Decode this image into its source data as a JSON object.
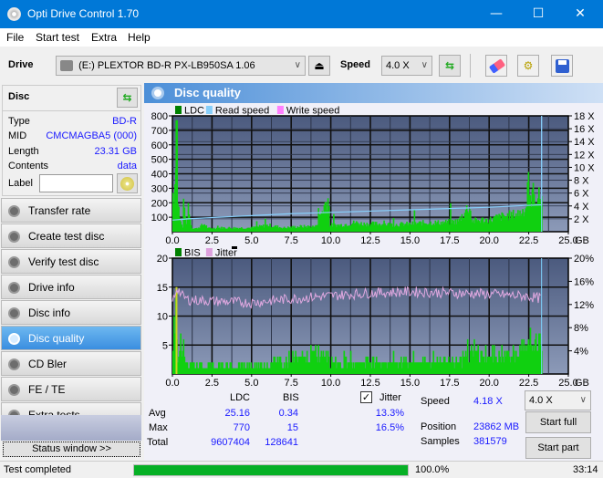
{
  "window": {
    "title": "Opti Drive Control 1.70",
    "minimize": "—",
    "maximize": "☐",
    "close": "✕"
  },
  "menu": [
    "File",
    "Start test",
    "Extra",
    "Help"
  ],
  "toolbar": {
    "drive_label": "Drive",
    "drive_value": "(E:)  PLEXTOR BD-R  PX-LB950SA 1.06",
    "speed_label": "Speed",
    "speed_value": "4.0 X"
  },
  "disc": {
    "title": "Disc",
    "rows": [
      {
        "label": "Type",
        "value": "BD-R"
      },
      {
        "label": "MID",
        "value": "CMCMAGBA5 (000)"
      },
      {
        "label": "Length",
        "value": "23.31 GB"
      },
      {
        "label": "Contents",
        "value": "data"
      }
    ],
    "label_field": {
      "label": "Label",
      "value": ""
    }
  },
  "nav": [
    {
      "label": "Transfer rate",
      "active": false
    },
    {
      "label": "Create test disc",
      "active": false
    },
    {
      "label": "Verify test disc",
      "active": false
    },
    {
      "label": "Drive info",
      "active": false
    },
    {
      "label": "Disc info",
      "active": false
    },
    {
      "label": "Disc quality",
      "active": true
    },
    {
      "label": "CD Bler",
      "active": false
    },
    {
      "label": "FE / TE",
      "active": false
    },
    {
      "label": "Extra tests",
      "active": false
    }
  ],
  "status_window_button": "Status window >>",
  "panel_title": "Disc quality",
  "chart_data": [
    {
      "type": "bar",
      "title": "LDC / Read speed",
      "legend": [
        "LDC",
        "Read speed",
        "Write speed"
      ],
      "legend_colors": {
        "LDC": "#008000",
        "Read speed": "#87cefa",
        "Write speed": "#ff80ff"
      },
      "xlabel": "GB",
      "xlim": [
        0,
        25
      ],
      "x_ticks": [
        "0.0",
        "2.5",
        "5.0",
        "7.5",
        "10.0",
        "12.5",
        "15.0",
        "17.5",
        "20.0",
        "22.5",
        "25.0"
      ],
      "ylim": [
        0,
        800
      ],
      "y_ticks": [
        "100",
        "200",
        "300",
        "400",
        "500",
        "600",
        "700",
        "800"
      ],
      "y2lim": [
        0,
        18
      ],
      "y2_ticks": [
        "2 X",
        "4 X",
        "6 X",
        "8 X",
        "10 X",
        "12 X",
        "14 X",
        "16 X",
        "18 X"
      ],
      "ldc_profile": [
        [
          0.0,
          300
        ],
        [
          0.1,
          280
        ],
        [
          0.2,
          770
        ],
        [
          0.3,
          250
        ],
        [
          0.4,
          120
        ],
        [
          0.5,
          60
        ],
        [
          0.6,
          40
        ],
        [
          0.7,
          300
        ],
        [
          0.8,
          40
        ],
        [
          1.0,
          150
        ],
        [
          1.2,
          30
        ],
        [
          1.5,
          25
        ],
        [
          2.0,
          60
        ],
        [
          2.2,
          25
        ],
        [
          3.0,
          30
        ],
        [
          4.0,
          30
        ],
        [
          5.0,
          30
        ],
        [
          6.0,
          50
        ],
        [
          7.0,
          30
        ],
        [
          8.0,
          40
        ],
        [
          9.0,
          40
        ],
        [
          9.8,
          270
        ],
        [
          9.9,
          50
        ],
        [
          10.5,
          50
        ],
        [
          11.0,
          60
        ],
        [
          11.5,
          70
        ],
        [
          12.0,
          60
        ],
        [
          13.0,
          60
        ],
        [
          14.0,
          55
        ],
        [
          15.0,
          60
        ],
        [
          16.0,
          70
        ],
        [
          17.0,
          70
        ],
        [
          18.0,
          80
        ],
        [
          18.7,
          200
        ],
        [
          18.9,
          80
        ],
        [
          19.5,
          90
        ],
        [
          20.0,
          90
        ],
        [
          20.5,
          110
        ],
        [
          21.0,
          120
        ],
        [
          21.5,
          130
        ],
        [
          22.0,
          150
        ],
        [
          22.5,
          220
        ],
        [
          22.7,
          300
        ],
        [
          23.0,
          250
        ],
        [
          23.3,
          280
        ],
        [
          23.31,
          0
        ]
      ],
      "read_speed": [
        [
          0.0,
          1.8
        ],
        [
          1.0,
          2.0
        ],
        [
          2.5,
          2.2
        ],
        [
          5.0,
          2.5
        ],
        [
          7.5,
          2.8
        ],
        [
          10.0,
          3.0
        ],
        [
          12.5,
          3.2
        ],
        [
          15.0,
          3.4
        ],
        [
          17.5,
          3.6
        ],
        [
          20.0,
          3.8
        ],
        [
          22.5,
          4.1
        ],
        [
          23.31,
          4.18
        ],
        [
          23.31,
          18
        ]
      ]
    },
    {
      "type": "bar",
      "title": "BIS / Jitter",
      "legend": [
        "BIS",
        "Jitter"
      ],
      "legend_colors": {
        "BIS": "#008000",
        "Jitter": "#dda0dd"
      },
      "xlabel": "GB",
      "xlim": [
        0,
        25
      ],
      "x_ticks": [
        "0.0",
        "2.5",
        "5.0",
        "7.5",
        "10.0",
        "12.5",
        "15.0",
        "17.5",
        "20.0",
        "22.5",
        "25.0"
      ],
      "ylim": [
        0,
        20
      ],
      "y_ticks": [
        "5",
        "10",
        "15",
        "20"
      ],
      "y2lim": [
        0,
        20
      ],
      "y2_ticks": [
        "4%",
        "8%",
        "12%",
        "16%",
        "20%"
      ],
      "bis_profile": [
        [
          0.0,
          7
        ],
        [
          0.2,
          15
        ],
        [
          0.3,
          5
        ],
        [
          0.6,
          6
        ],
        [
          0.8,
          3
        ],
        [
          1.0,
          2
        ],
        [
          5.0,
          2
        ],
        [
          9.8,
          5
        ],
        [
          10.0,
          3
        ],
        [
          12.0,
          3
        ],
        [
          14.0,
          3
        ],
        [
          16.0,
          3
        ],
        [
          18.0,
          4
        ],
        [
          19.0,
          5
        ],
        [
          20.0,
          4
        ],
        [
          21.0,
          5
        ],
        [
          22.0,
          5
        ],
        [
          22.5,
          7
        ],
        [
          22.8,
          9
        ],
        [
          23.0,
          7
        ],
        [
          23.3,
          5
        ],
        [
          23.31,
          0
        ]
      ],
      "jitter_profile": [
        [
          0.0,
          12.5
        ],
        [
          0.3,
          15.0
        ],
        [
          0.6,
          13.5
        ],
        [
          1.0,
          12.8
        ],
        [
          2.5,
          12.6
        ],
        [
          5.0,
          12.3
        ],
        [
          7.5,
          13.0
        ],
        [
          10.0,
          13.5
        ],
        [
          12.5,
          14.0
        ],
        [
          15.0,
          14.2
        ],
        [
          17.5,
          14.0
        ],
        [
          20.0,
          13.8
        ],
        [
          22.5,
          13.4
        ],
        [
          23.3,
          13.0
        ]
      ]
    }
  ],
  "stats": {
    "col_ldc": "LDC",
    "col_bis": "BIS",
    "jitter_label": "Jitter",
    "jitter_checked": true,
    "rows": [
      {
        "label": "Avg",
        "ldc": "25.16",
        "bis": "0.34",
        "jitter": "13.3%"
      },
      {
        "label": "Max",
        "ldc": "770",
        "bis": "15",
        "jitter": "16.5%"
      },
      {
        "label": "Total",
        "ldc": "9607404",
        "bis": "128641",
        "jitter": ""
      }
    ],
    "speed_label": "Speed",
    "speed_value": "4.18 X",
    "position_label": "Position",
    "position_value": "23862 MB",
    "samples_label": "Samples",
    "samples_value": "381579",
    "speed_select": "4.0 X",
    "start_full": "Start full",
    "start_part": "Start part"
  },
  "status": {
    "text": "Test completed",
    "progress_percent": 100.0,
    "progress_label": "100.0%",
    "time": "33:14"
  }
}
